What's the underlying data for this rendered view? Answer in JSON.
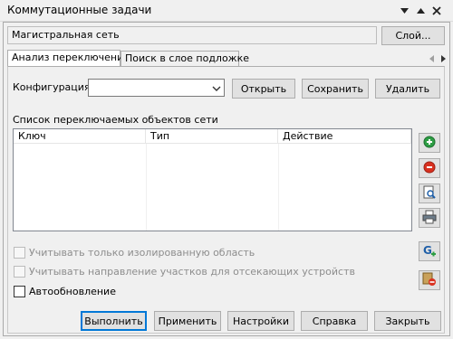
{
  "window": {
    "title": "Коммутационные задачи"
  },
  "layer": {
    "value": "Магистральная сеть",
    "button": "Слой..."
  },
  "tabs": [
    {
      "label": "Анализ переключений",
      "active": true
    },
    {
      "label": "Поиск в слое подложке",
      "active": false
    }
  ],
  "config": {
    "label": "Конфигурация:",
    "value": "",
    "open": "Открыть",
    "save": "Сохранить",
    "delete": "Удалить"
  },
  "list": {
    "label": "Список переключаемых объектов сети",
    "columns": [
      "Ключ",
      "Тип",
      "Действие"
    ],
    "rows": []
  },
  "side_tools": [
    "add-icon",
    "remove-icon",
    "zoom-to-icon",
    "print-icon",
    "graph-add-icon",
    "layer-remove-icon"
  ],
  "options": {
    "isolated": {
      "label": "Учитывать только изолированную область",
      "checked": false,
      "enabled": false
    },
    "direction": {
      "label": "Учитывать направление участков для отсекающих устройств",
      "checked": false,
      "enabled": false
    },
    "autoupdate": {
      "label": "Автообновление",
      "checked": false,
      "enabled": true
    }
  },
  "footer": {
    "run": "Выполнить",
    "apply": "Применить",
    "settings": "Настройки",
    "help": "Справка",
    "close": "Закрыть"
  },
  "colors": {
    "accent": "#0078d7",
    "add": "#2e9e45",
    "remove": "#d9301f"
  }
}
